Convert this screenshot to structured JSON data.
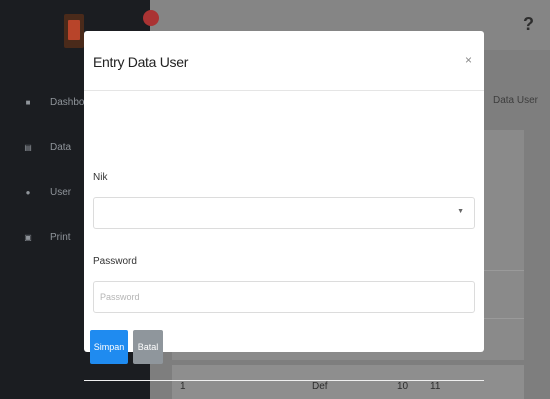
{
  "sidebar": {
    "items": [
      {
        "icon": "dashboard-icon",
        "glyph": "■",
        "label": "Dashboard"
      },
      {
        "icon": "data-icon",
        "glyph": "▤",
        "label": "Data"
      },
      {
        "icon": "user-icon",
        "glyph": "●",
        "label": "User"
      },
      {
        "icon": "print-icon",
        "glyph": "▣",
        "label": "Print"
      }
    ]
  },
  "topbar": {
    "help_glyph": "?"
  },
  "breadcrumb": {
    "current": "Data User"
  },
  "modal": {
    "title": "Entry Data User",
    "close_glyph": "×",
    "nik_label": "Nik",
    "select_arrow": "▼",
    "password_label": "Password",
    "password_placeholder": "Password",
    "save_label": "Simpan",
    "cancel_label": "Batal"
  },
  "table": {
    "cells": [
      "1",
      "Def",
      "10",
      "11"
    ]
  },
  "colors": {
    "primary": "#1f8bf0",
    "secondary": "#8f969c",
    "sidebar": "#1b1d21"
  }
}
